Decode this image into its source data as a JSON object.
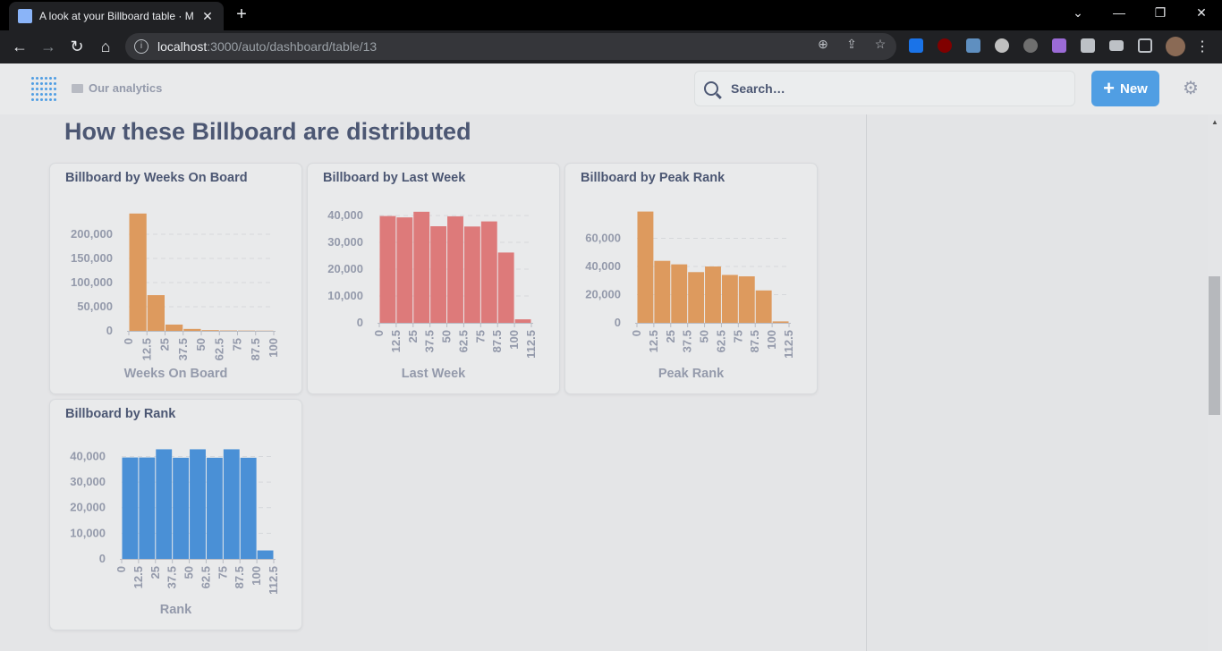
{
  "browser": {
    "tab_title": "A look at your Billboard table · M",
    "url_host": "localhost",
    "url_path": ":3000/auto/dashboard/table/13",
    "tab_close": "✕",
    "new_tab": "+"
  },
  "app": {
    "breadcrumb": "Our analytics",
    "search_placeholder": "Search…",
    "new_label": "New",
    "page_heading": "How these Billboard are distributed"
  },
  "colors": {
    "orange": "#dd9a5e",
    "red": "#dd7a7a",
    "blue": "#4a90d6",
    "brand": "#509ee3"
  },
  "chart_data": [
    {
      "type": "bar",
      "title": "Billboard by Weeks On Board",
      "xlabel": "Weeks On Board",
      "ylabel": "",
      "color": "#dd9a5e",
      "bin_width": 12.5,
      "bin_starts": [
        0,
        12.5,
        25,
        37.5,
        50,
        62.5,
        75,
        87.5
      ],
      "values": [
        243000,
        74000,
        13000,
        4000,
        1500,
        800,
        600,
        400
      ],
      "x_ticks": [
        "0",
        "12.5",
        "25",
        "37.5",
        "50",
        "62.5",
        "75",
        "87.5",
        "100"
      ],
      "y_ticks": [
        "0",
        "50,000",
        "100,000",
        "150,000",
        "200,000"
      ],
      "ylim": [
        0,
        250000
      ],
      "xlim": [
        0,
        100
      ]
    },
    {
      "type": "bar",
      "title": "Billboard by Last Week",
      "xlabel": "Last Week",
      "ylabel": "",
      "color": "#dd7a7a",
      "bin_width": 12.5,
      "bin_starts": [
        0,
        12.5,
        25,
        37.5,
        50,
        62.5,
        75,
        87.5,
        100
      ],
      "values": [
        39800,
        39300,
        41400,
        36000,
        39700,
        35900,
        37800,
        26200,
        1300
      ],
      "x_ticks": [
        "0",
        "12.5",
        "25",
        "37.5",
        "50",
        "62.5",
        "75",
        "87.5",
        "100",
        "112.5"
      ],
      "y_ticks": [
        "0",
        "10,000",
        "20,000",
        "30,000",
        "40,000"
      ],
      "ylim": [
        0,
        42000
      ],
      "xlim": [
        0,
        112.5
      ]
    },
    {
      "type": "bar",
      "title": "Billboard by Peak Rank",
      "xlabel": "Peak Rank",
      "ylabel": "",
      "color": "#dd9a5e",
      "bin_width": 12.5,
      "bin_starts": [
        0,
        12.5,
        25,
        37.5,
        50,
        62.5,
        75,
        87.5,
        100
      ],
      "values": [
        79000,
        44000,
        41500,
        36000,
        40000,
        34000,
        33000,
        23000,
        1000
      ],
      "x_ticks": [
        "0",
        "12.5",
        "25",
        "37.5",
        "50",
        "62.5",
        "75",
        "87.5",
        "100",
        "112.5"
      ],
      "y_ticks": [
        "0",
        "20,000",
        "40,000",
        "60,000"
      ],
      "ylim": [
        0,
        80000
      ],
      "xlim": [
        0,
        112.5
      ]
    },
    {
      "type": "bar",
      "title": "Billboard by Rank",
      "xlabel": "Rank",
      "ylabel": "",
      "color": "#4a90d6",
      "bin_width": 12.5,
      "bin_starts": [
        0,
        12.5,
        25,
        37.5,
        50,
        62.5,
        75,
        87.5,
        100
      ],
      "values": [
        39600,
        39600,
        42800,
        39500,
        42800,
        39500,
        42800,
        39500,
        3300
      ],
      "x_ticks": [
        "0",
        "12.5",
        "25",
        "37.5",
        "50",
        "62.5",
        "75",
        "87.5",
        "100",
        "112.5"
      ],
      "y_ticks": [
        "0",
        "10,000",
        "20,000",
        "30,000",
        "40,000"
      ],
      "ylim": [
        0,
        44000
      ],
      "xlim": [
        0,
        112.5
      ]
    }
  ]
}
